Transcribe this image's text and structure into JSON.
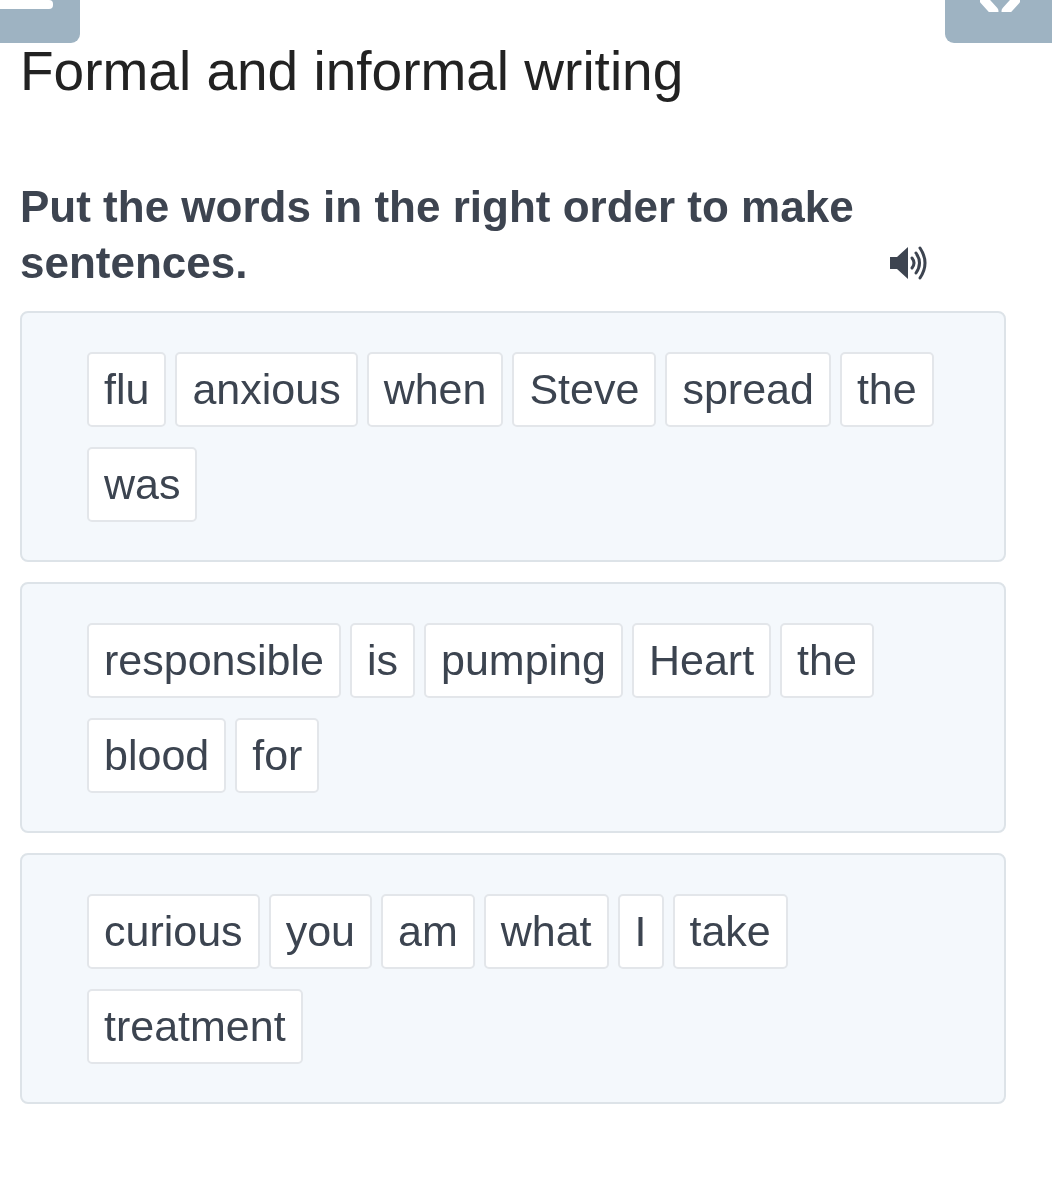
{
  "title": "Formal and informal writing",
  "instruction": "Put the words in the right order to make sentences.",
  "sentences": [
    {
      "words": [
        "flu",
        "anxious",
        "when",
        "Steve",
        "spread",
        "the",
        "was"
      ]
    },
    {
      "words": [
        "responsible",
        "is",
        "pumping",
        "Heart",
        "the",
        "blood",
        "for"
      ]
    },
    {
      "words": [
        "curious",
        "you",
        "am",
        "what",
        "I",
        "take",
        "treatment"
      ]
    }
  ]
}
